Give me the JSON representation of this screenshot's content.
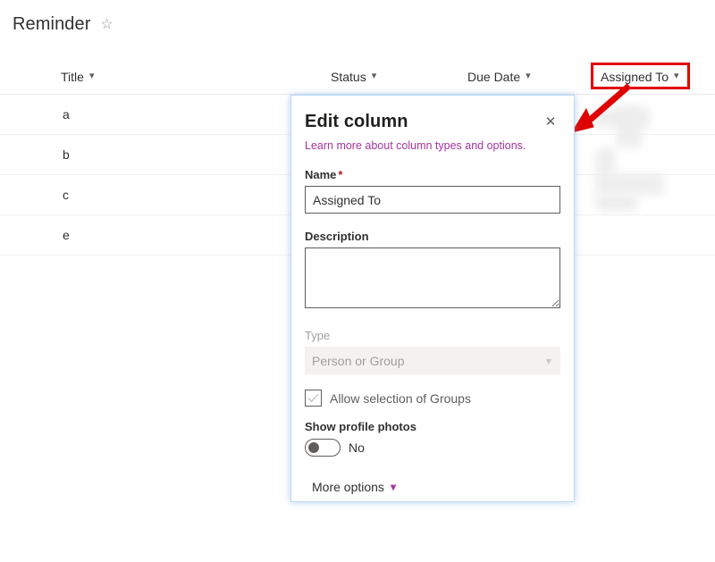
{
  "page": {
    "title": "Reminder",
    "favorite_icon": "star-outline-icon"
  },
  "list": {
    "columns": [
      {
        "label": "Title",
        "sort_icon": "chevron-down-icon"
      },
      {
        "label": "Status",
        "sort_icon": "chevron-down-icon"
      },
      {
        "label": "Due Date",
        "sort_icon": "chevron-down-icon"
      },
      {
        "label": "Assigned To",
        "sort_icon": "chevron-down-icon"
      }
    ],
    "rows": [
      {
        "title": "a",
        "status": "",
        "due_date": "",
        "assigned_to": ""
      },
      {
        "title": "b",
        "status": "",
        "due_date": "",
        "assigned_to": ""
      },
      {
        "title": "c",
        "status": "",
        "due_date": "",
        "assigned_to": ""
      },
      {
        "title": "e",
        "status": "",
        "due_date": "",
        "assigned_to": ""
      }
    ]
  },
  "annotation": {
    "highlight_color": "#e00000",
    "highlight_target": "Assigned To",
    "arrow_color": "#e00000",
    "arrow_direction": "down-left"
  },
  "dialog": {
    "title": "Edit column",
    "close_icon": "close-icon",
    "learn_more_link": "Learn more about column types and options.",
    "link_color": "#a4369e",
    "name": {
      "label": "Name",
      "required_marker": "*",
      "value": "Assigned To",
      "placeholder": ""
    },
    "description": {
      "label": "Description",
      "value": "",
      "placeholder": ""
    },
    "type": {
      "label": "Type",
      "value": "Person or Group",
      "disabled": true,
      "chevron_icon": "chevron-down-icon"
    },
    "allow_groups": {
      "label": "Allow selection of Groups",
      "checked": true,
      "check_icon": "checkmark-icon"
    },
    "show_profile_photos": {
      "label": "Show profile photos",
      "value": "No",
      "on": false
    },
    "more_options": {
      "label": "More options",
      "chevron_icon": "chevron-down-icon"
    }
  }
}
